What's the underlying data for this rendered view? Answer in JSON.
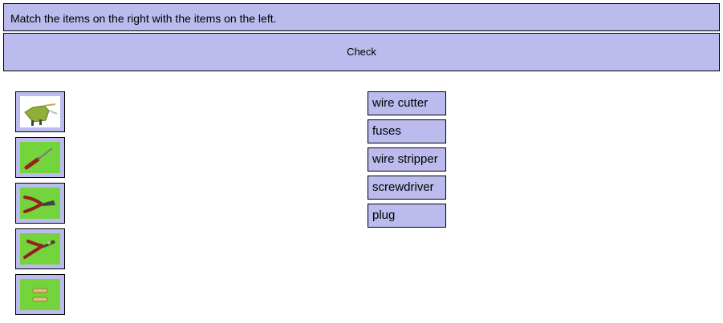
{
  "instructions": "Match the items on the right with the items on the left.",
  "check_label": "Check",
  "images": [
    {
      "name": "plug-image"
    },
    {
      "name": "screwdriver-image"
    },
    {
      "name": "wire-cutter-image"
    },
    {
      "name": "wire-stripper-image"
    },
    {
      "name": "fuses-image"
    }
  ],
  "words": [
    "wire cutter",
    "fuses",
    "wire stripper",
    "screwdriver",
    "plug"
  ],
  "colors": {
    "panel": "#bbbbed",
    "image_background": "#73d43c",
    "border": "#000000"
  }
}
